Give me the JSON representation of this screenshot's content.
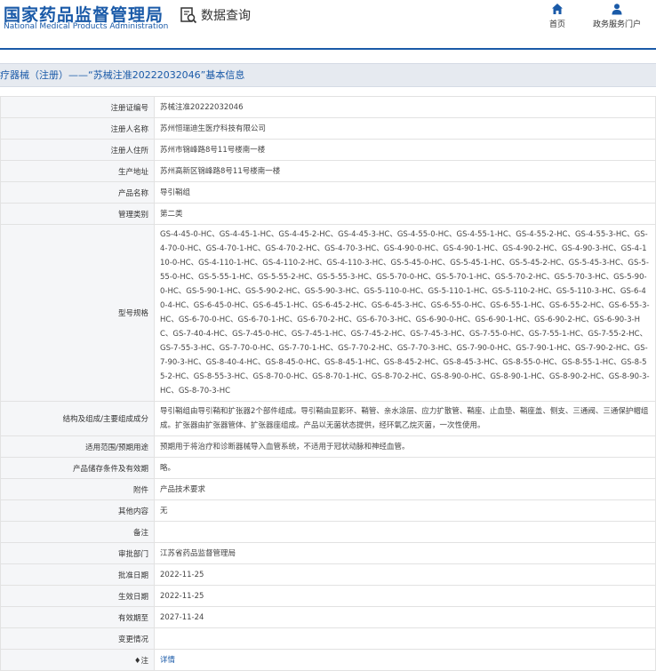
{
  "header": {
    "logo_cn": "国家药品监督管理局",
    "logo_en": "National Medical Products Administration",
    "query_label": "数据查询",
    "nav": {
      "home": "首页",
      "portal": "政务服务门户"
    }
  },
  "title": "疗器械（注册）——“苏械注准20222032046”基本信息",
  "rows": {
    "reg_no": {
      "label": "注册证编号",
      "value": "苏械注准20222032046"
    },
    "registrant": {
      "label": "注册人名称",
      "value": "苏州恒瑞迪生医疗科技有限公司"
    },
    "registrant_addr": {
      "label": "注册人住所",
      "value": "苏州市锦峰路8号11号楼南一楼"
    },
    "prod_addr": {
      "label": "生产地址",
      "value": "苏州高新区锦峰路8号11号楼南一楼"
    },
    "product_name": {
      "label": "产品名称",
      "value": "导引鞘组"
    },
    "category": {
      "label": "管理类别",
      "value": "第二类"
    },
    "models": {
      "label": "型号规格",
      "value": "GS-4-45-0-HC、GS-4-45-1-HC、GS-4-45-2-HC、GS-4-45-3-HC、GS-4-55-0-HC、GS-4-55-1-HC、GS-4-55-2-HC、GS-4-55-3-HC、GS-4-70-0-HC、GS-4-70-1-HC、GS-4-70-2-HC、GS-4-70-3-HC、GS-4-90-0-HC、GS-4-90-1-HC、GS-4-90-2-HC、GS-4-90-3-HC、GS-4-110-0-HC、GS-4-110-1-HC、GS-4-110-2-HC、GS-4-110-3-HC、GS-5-45-0-HC、GS-5-45-1-HC、GS-5-45-2-HC、GS-5-45-3-HC、GS-5-55-0-HC、GS-5-55-1-HC、GS-5-55-2-HC、GS-5-55-3-HC、GS-5-70-0-HC、GS-5-70-1-HC、GS-5-70-2-HC、GS-5-70-3-HC、GS-5-90-0-HC、GS-5-90-1-HC、GS-5-90-2-HC、GS-5-90-3-HC、GS-5-110-0-HC、GS-5-110-1-HC、GS-5-110-2-HC、GS-5-110-3-HC、GS-6-40-4-HC、GS-6-45-0-HC、GS-6-45-1-HC、GS-6-45-2-HC、GS-6-45-3-HC、GS-6-55-0-HC、GS-6-55-1-HC、GS-6-55-2-HC、GS-6-55-3-HC、GS-6-70-0-HC、GS-6-70-1-HC、GS-6-70-2-HC、GS-6-70-3-HC、GS-6-90-0-HC、GS-6-90-1-HC、GS-6-90-2-HC、GS-6-90-3-HC、GS-7-40-4-HC、GS-7-45-0-HC、GS-7-45-1-HC、GS-7-45-2-HC、GS-7-45-3-HC、GS-7-55-0-HC、GS-7-55-1-HC、GS-7-55-2-HC、GS-7-55-3-HC、GS-7-70-0-HC、GS-7-70-1-HC、GS-7-70-2-HC、GS-7-70-3-HC、GS-7-90-0-HC、GS-7-90-1-HC、GS-7-90-2-HC、GS-7-90-3-HC、GS-8-40-4-HC、GS-8-45-0-HC、GS-8-45-1-HC、GS-8-45-2-HC、GS-8-45-3-HC、GS-8-55-0-HC、GS-8-55-1-HC、GS-8-55-2-HC、GS-8-55-3-HC、GS-8-70-0-HC、GS-8-70-1-HC、GS-8-70-2-HC、GS-8-90-0-HC、GS-8-90-1-HC、GS-8-90-2-HC、GS-8-90-3-HC、GS-8-70-3-HC"
    },
    "structure": {
      "label": "结构及组成/主要组成成分",
      "value": "导引鞘组由导引鞘和扩张器2个部件组成。导引鞘由显影环、鞘管、亲水涂层、应力扩散管、鞘座、止血垫、鞘座盖、侧支、三通阀、三通保护帽组成。扩张器由扩张器管体、扩张器座组成。产品以无菌状态提供，经环氧乙烷灭菌，一次性使用。"
    },
    "scope": {
      "label": "适用范围/预期用途",
      "value": "预期用于将治疗和诊断器械导入血管系统，不适用于冠状动脉和神经血管。"
    },
    "storage": {
      "label": "产品储存条件及有效期",
      "value": "略。"
    },
    "attachment": {
      "label": "附件",
      "value": "产品技术要求"
    },
    "other": {
      "label": "其他内容",
      "value": "无"
    },
    "remark": {
      "label": "备注",
      "value": ""
    },
    "authority": {
      "label": "审批部门",
      "value": "江苏省药品监督管理局"
    },
    "approval_date": {
      "label": "批准日期",
      "value": "2022-11-25"
    },
    "effective_date": {
      "label": "生效日期",
      "value": "2022-11-25"
    },
    "expiry_date": {
      "label": "有效期至",
      "value": "2027-11-24"
    },
    "change": {
      "label": "变更情况",
      "value": ""
    },
    "note": {
      "label": "注",
      "value": "详情"
    }
  }
}
